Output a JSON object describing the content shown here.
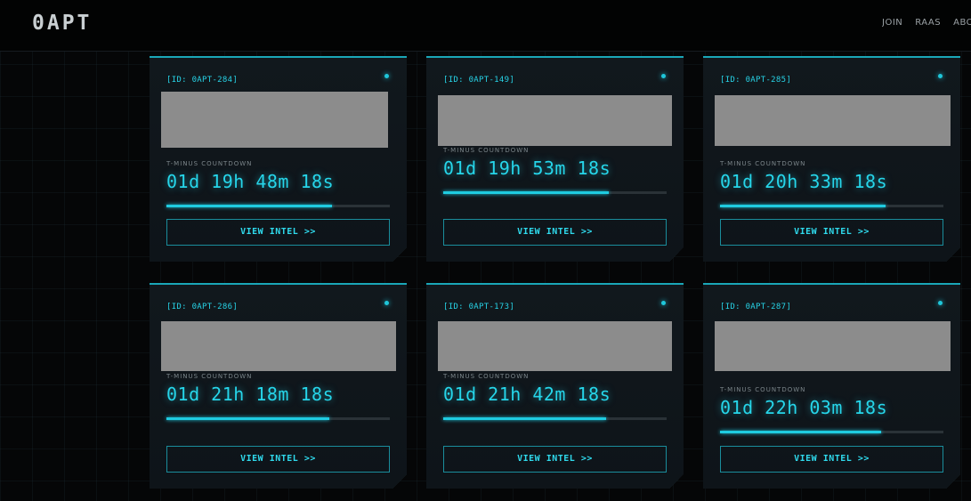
{
  "header": {
    "logo": "0APT",
    "nav": [
      "JOIN",
      "RAAS",
      "ABOUT"
    ]
  },
  "countdown_label": "T-MINUS COUNTDOWN",
  "button_label": "VIEW INTEL >>",
  "colors": {
    "accent": "#26d6ea",
    "background": "#050607",
    "card": "#11181d",
    "thumbnail": "#8c8c8c"
  },
  "cards": [
    {
      "id": "[ID: 0APT-284]",
      "countdown": "01d 19h 48m 18s",
      "progress": 0.74
    },
    {
      "id": "[ID: 0APT-149]",
      "countdown": "01d 19h 53m 18s",
      "progress": 0.74
    },
    {
      "id": "[ID: 0APT-285]",
      "countdown": "01d 20h 33m 18s",
      "progress": 0.74
    },
    {
      "id": "[ID: 0APT-286]",
      "countdown": "01d 21h 18m 18s",
      "progress": 0.73
    },
    {
      "id": "[ID: 0APT-173]",
      "countdown": "01d 21h 42m 18s",
      "progress": 0.73
    },
    {
      "id": "[ID: 0APT-287]",
      "countdown": "01d 22h 03m 18s",
      "progress": 0.72
    }
  ]
}
